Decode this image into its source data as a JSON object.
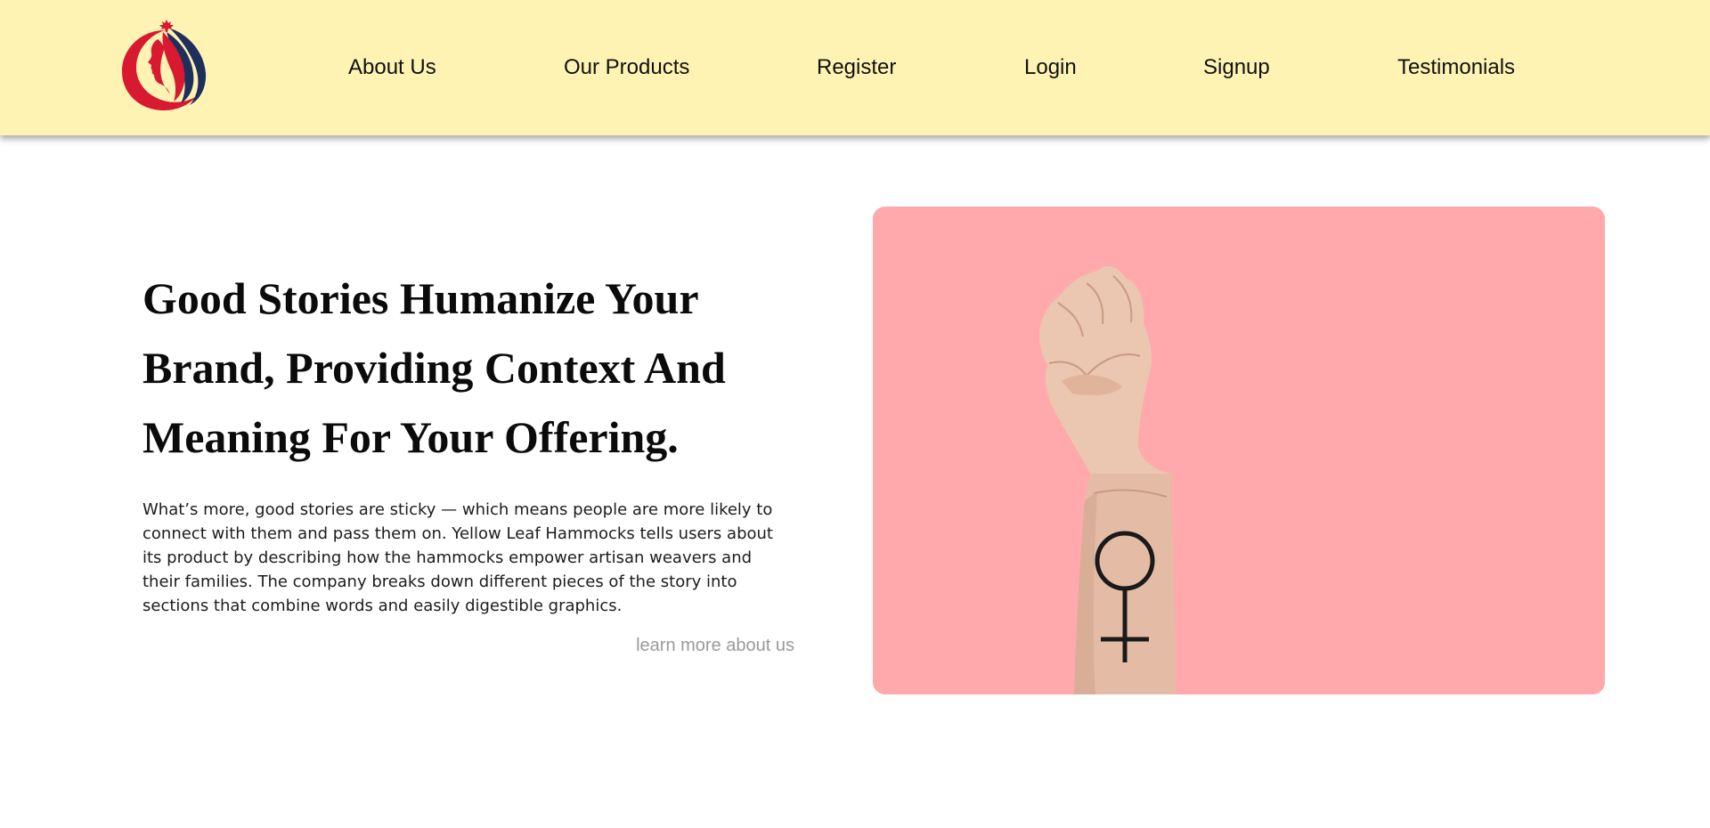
{
  "brand": {
    "logo_icon": "woman-profile-maple-leaf-logo",
    "colors": {
      "header_bg": "#fff3b4",
      "logo_red": "#d8192f",
      "logo_navy": "#1f2f5c",
      "image_bg": "#ffa9ad"
    }
  },
  "nav": {
    "items": [
      {
        "label": "About Us"
      },
      {
        "label": "Our Products"
      },
      {
        "label": "Register"
      },
      {
        "label": "Login"
      },
      {
        "label": "Signup"
      },
      {
        "label": "Testimonials"
      }
    ]
  },
  "hero": {
    "title": "Good Stories Humanize Your Brand, Providing Context And Meaning For Your Offering.",
    "body": "What’s more, good stories are sticky — which means people are more likely to connect with them and pass them on. Yellow Leaf Hammocks tells users about its product by describing how the hammocks empower artisan weavers and their families. The company breaks down different pieces of the story into sections that combine words and easily digestible graphics.",
    "link_label": "learn more about us",
    "image_icon": "raised-fist-female-symbol-image"
  }
}
